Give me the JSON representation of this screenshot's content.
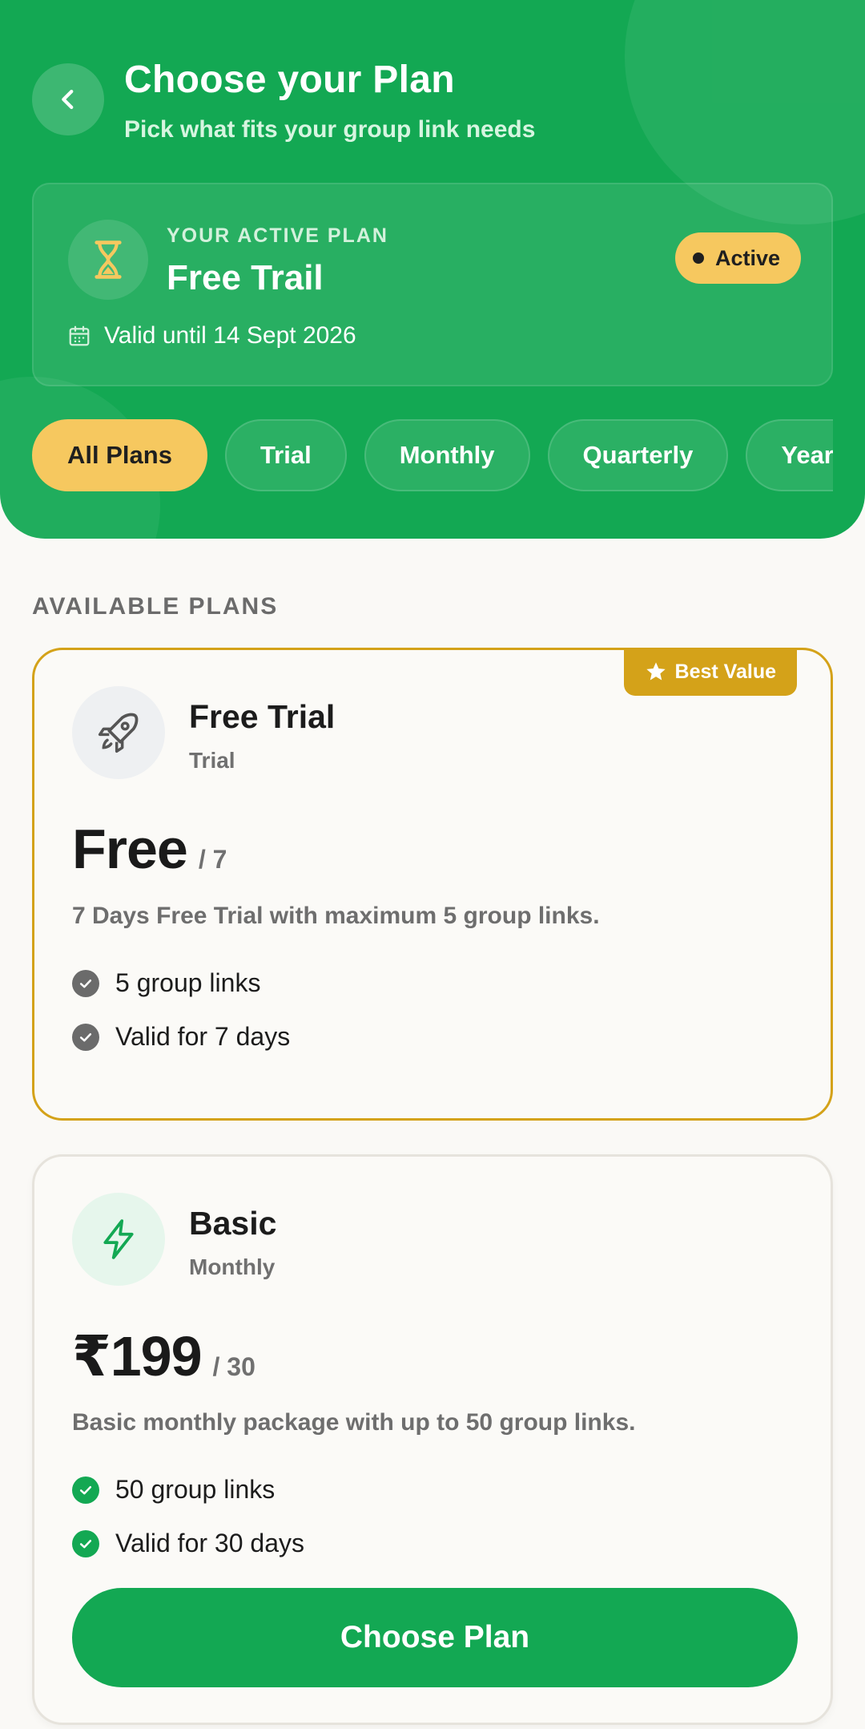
{
  "header": {
    "title": "Choose your Plan",
    "subtitle": "Pick what fits your group link needs",
    "back_icon": "chevron-left-icon"
  },
  "active_plan": {
    "label": "YOUR ACTIVE PLAN",
    "name": "Free Trail",
    "badge": "Active",
    "valid_text": "Valid until 14 Sept 2026",
    "icon": "hourglass-icon"
  },
  "tabs": [
    {
      "label": "All Plans",
      "selected": true
    },
    {
      "label": "Trial",
      "selected": false
    },
    {
      "label": "Monthly",
      "selected": false
    },
    {
      "label": "Quarterly",
      "selected": false
    },
    {
      "label": "Yearly",
      "selected": false
    }
  ],
  "section_label": "AVAILABLE PLANS",
  "plans": [
    {
      "badge": "Best Value",
      "name": "Free Trial",
      "type": "Trial",
      "price": "Free",
      "per": "/ 7",
      "description": "7 Days Free Trial with maximum 5 group links.",
      "features": [
        "5 group links",
        "Valid for 7 days"
      ],
      "icon": "rocket-icon",
      "check_color": "#6b6b6b"
    },
    {
      "name": "Basic",
      "type": "Monthly",
      "price": "₹199",
      "per": "/ 30",
      "description": "Basic monthly package with up to 50 group links.",
      "features": [
        "50 group links",
        "Valid for 30 days"
      ],
      "button": "Choose Plan",
      "icon": "lightning-icon",
      "check_color": "#13a853"
    }
  ],
  "colors": {
    "primary": "#13a853",
    "accent_yellow": "#f6c85f",
    "gold": "#d4a219"
  }
}
